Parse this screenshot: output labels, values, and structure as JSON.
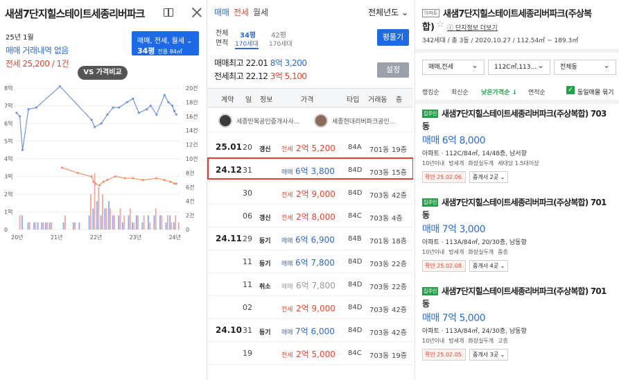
{
  "panel1": {
    "title": "새샘7단지힐스테이트세종리버파크",
    "month": "25년 1월",
    "no_sale": "매매 거래내역 없음",
    "jeonse": "전세 25,200 / 1건",
    "filter": {
      "types": "매매, 전세, 월세 ⌄",
      "area": "34평",
      "area_sub": "전용 84㎡"
    },
    "vs_label": "VS 가격비교"
  },
  "chart_data": {
    "type": "line",
    "x_ticks": [
      "20년",
      "21년",
      "22년",
      "23년",
      "24년"
    ],
    "y_left_ticks": [
      "8억",
      "7억",
      "6억",
      "5억",
      "4억",
      "3억",
      "2억",
      "1억",
      "0"
    ],
    "y_right_ticks": [
      "20건",
      "18건",
      "16건",
      "14건",
      "12건",
      "10건",
      "8건",
      "6건",
      "4건",
      "2건",
      "0"
    ],
    "ylim_left": [
      0,
      8
    ],
    "ylim_right": [
      0,
      20
    ],
    "series": [
      {
        "color": "#6f95e0",
        "points": [
          [
            2020.0,
            6.6
          ],
          [
            2020.08,
            6.4
          ],
          [
            2020.15,
            4.5
          ],
          [
            2020.3,
            6.8
          ],
          [
            2020.5,
            6.9
          ],
          [
            2021.1,
            8.1
          ],
          [
            2021.9,
            6.2
          ],
          [
            2021.98,
            5.8
          ],
          [
            2022.15,
            6.0
          ],
          [
            2022.3,
            6.5
          ],
          [
            2022.45,
            6.9
          ],
          [
            2022.6,
            6.9
          ],
          [
            2022.8,
            7.2
          ],
          [
            2022.95,
            7.4
          ],
          [
            2023.1,
            6.6
          ],
          [
            2023.3,
            6.8
          ],
          [
            2023.4,
            7.0
          ],
          [
            2023.55,
            6.5
          ],
          [
            2023.75,
            7.6
          ],
          [
            2023.85,
            7.2
          ],
          [
            2023.95,
            7.0
          ],
          [
            2024.0,
            6.7
          ],
          [
            2024.05,
            6.5
          ]
        ]
      },
      {
        "color": "#f0936e",
        "points": [
          [
            2021.15,
            3.5
          ],
          [
            2021.55,
            3.2
          ],
          [
            2021.9,
            3.0
          ],
          [
            2021.95,
            2.7
          ],
          [
            2022.0,
            2.6
          ],
          [
            2022.1,
            2.5
          ],
          [
            2022.2,
            2.7
          ],
          [
            2022.3,
            2.8
          ],
          [
            2022.5,
            3.0
          ],
          [
            2022.75,
            2.9
          ],
          [
            2022.95,
            2.9
          ],
          [
            2023.2,
            2.8
          ],
          [
            2023.55,
            2.9
          ],
          [
            2023.75,
            2.8
          ],
          [
            2023.9,
            2.7
          ],
          [
            2024.0,
            2.6
          ],
          [
            2024.05,
            2.6
          ]
        ]
      }
    ],
    "volume_bars": [
      {
        "x": 2020.05,
        "sale": 0,
        "jeonse": 2
      },
      {
        "x": 2020.15,
        "sale": 2,
        "jeonse": 0
      },
      {
        "x": 2020.3,
        "sale": 1,
        "jeonse": 1
      },
      {
        "x": 2020.45,
        "sale": 1,
        "jeonse": 1
      },
      {
        "x": 2020.55,
        "sale": 1,
        "jeonse": 0
      },
      {
        "x": 2020.65,
        "sale": 1,
        "jeonse": 1
      },
      {
        "x": 2020.75,
        "sale": 1,
        "jeonse": 1
      },
      {
        "x": 2020.85,
        "sale": 1,
        "jeonse": 1
      },
      {
        "x": 2021.2,
        "sale": 1,
        "jeonse": 2
      },
      {
        "x": 2021.45,
        "sale": 1,
        "jeonse": 1
      },
      {
        "x": 2021.6,
        "sale": 1,
        "jeonse": 0
      },
      {
        "x": 2021.85,
        "sale": 2,
        "jeonse": 5
      },
      {
        "x": 2021.95,
        "sale": 3,
        "jeonse": 8
      },
      {
        "x": 2022.05,
        "sale": 4,
        "jeonse": 6
      },
      {
        "x": 2022.15,
        "sale": 2,
        "jeonse": 5
      },
      {
        "x": 2022.25,
        "sale": 3,
        "jeonse": 3
      },
      {
        "x": 2022.35,
        "sale": 4,
        "jeonse": 3
      },
      {
        "x": 2022.45,
        "sale": 2,
        "jeonse": 2
      },
      {
        "x": 2022.6,
        "sale": 2,
        "jeonse": 3
      },
      {
        "x": 2022.7,
        "sale": 1,
        "jeonse": 2
      },
      {
        "x": 2022.85,
        "sale": 2,
        "jeonse": 3
      },
      {
        "x": 2022.95,
        "sale": 1,
        "jeonse": 1
      },
      {
        "x": 2023.05,
        "sale": 2,
        "jeonse": 2
      },
      {
        "x": 2023.2,
        "sale": 1,
        "jeonse": 2
      },
      {
        "x": 2023.35,
        "sale": 2,
        "jeonse": 1
      },
      {
        "x": 2023.5,
        "sale": 2,
        "jeonse": 3
      },
      {
        "x": 2023.65,
        "sale": 2,
        "jeonse": 2
      },
      {
        "x": 2023.8,
        "sale": 1,
        "jeonse": 2
      },
      {
        "x": 2023.9,
        "sale": 2,
        "jeonse": 1
      },
      {
        "x": 2024.0,
        "sale": 1,
        "jeonse": 2
      },
      {
        "x": 2024.08,
        "sale": 0,
        "jeonse": 1
      }
    ],
    "bar_colors": {
      "sale": "#8ea8ee",
      "jeonse": "#f3a79a"
    }
  },
  "panel2": {
    "tabs": [
      "매매",
      "전세",
      "월세"
    ],
    "year_select": "전체년도 ⌄",
    "area_label": "전체",
    "area_label2": "면적",
    "area_selected": "34평",
    "area_other": "42평",
    "hh_selected": "170세대",
    "hh_other": "170세대",
    "pyeong_btn": "평풀기",
    "max_sale": {
      "label": "매매최고",
      "date": "22.01",
      "price": "8억 3,200"
    },
    "max_jeonse": {
      "label": "전세최고",
      "date": "22.12",
      "price": "3억 5,100"
    },
    "setting_btn": "설정",
    "headers": [
      "계약",
      "일",
      "정보",
      "가격",
      "타입",
      "거래동",
      "층"
    ],
    "agents": [
      "세종만복공인중개사사...",
      "세종현대리버파크공인..."
    ],
    "rows": [
      {
        "date": "25.01",
        "day": "20",
        "info": "갱신",
        "type": "전세",
        "price": "2억 5,200",
        "unit": "84A",
        "dong": "701동",
        "floor": "19층",
        "kind": "jeon"
      },
      {
        "date": "24.12",
        "day": "31",
        "info": "",
        "type": "매매",
        "price": "6억 3,800",
        "unit": "84D",
        "dong": "703동",
        "floor": "15층",
        "kind": "sale"
      },
      {
        "date": "",
        "day": "30",
        "info": "",
        "type": "전세",
        "price": "2억 9,000",
        "unit": "84D",
        "dong": "703동",
        "floor": "42층",
        "kind": "jeon"
      },
      {
        "date": "",
        "day": "06",
        "info": "갱신",
        "type": "전세",
        "price": "2억 8,000",
        "unit": "84C",
        "dong": "703동",
        "floor": "4층",
        "kind": "jeon"
      },
      {
        "date": "24.11",
        "day": "29",
        "info": "등기",
        "type": "매매",
        "price": "6억 6,900",
        "unit": "84B",
        "dong": "701동",
        "floor": "18층",
        "kind": "sale"
      },
      {
        "date": "",
        "day": "11",
        "info": "등기",
        "type": "매매",
        "price": "6억 7,800",
        "unit": "84D",
        "dong": "703동",
        "floor": "22층",
        "kind": "sale"
      },
      {
        "date": "",
        "day": "11",
        "info": "취소",
        "type": "매매",
        "price": "6억 7,800",
        "unit": "84D",
        "dong": "703동",
        "floor": "22층",
        "kind": "cancel"
      },
      {
        "date": "",
        "day": "02",
        "info": "",
        "type": "전세",
        "price": "2억 9,000",
        "unit": "84D",
        "dong": "703동",
        "floor": "42층",
        "kind": "jeon"
      },
      {
        "date": "24.10",
        "day": "31",
        "info": "등기",
        "type": "매매",
        "price": "7억 6,000",
        "unit": "84D",
        "dong": "703동",
        "floor": "42층",
        "kind": "sale"
      },
      {
        "date": "",
        "day": "19",
        "info": "",
        "type": "전세",
        "price": "2억 5,000",
        "unit": "84C",
        "dong": "703동",
        "floor": "19층",
        "kind": "jeon"
      }
    ]
  },
  "panel3": {
    "badge": "아파트",
    "title_line1": "새샘7단지힐스테이트세종리버파크(주상복",
    "title_line2": "합)",
    "info_link": "단지정보 더보기",
    "meta": "342세대 / 총 3동 / 2020.10.27 / 112.54㎡ ~ 189.3㎡",
    "dropdowns": [
      "매매,전세",
      "112C㎡,113...",
      "전체동"
    ],
    "sorts": [
      "랭킹순",
      "최신순",
      "낮은가격순 ↓",
      "면적순"
    ],
    "same_listing": "동일매물 묶기",
    "cards": [
      {
        "tag": "집주인",
        "name1": "새샘7단지힐스테이트세종리버파크(주상복합) 703",
        "name2": "동",
        "price": "매매 6억 8,000",
        "spec": "아파트 · 112C/84㎡, 14/48층, 남서향",
        "tags": [
          "10년이내",
          "방세개",
          "화장실두개",
          "세대당 1.5대이상"
        ],
        "confirm": "확인 25.02.06.",
        "broker": "중개사 2곳"
      },
      {
        "tag": "집주인",
        "name1": "새샘7단지힐스테이트세종리버파크(주상복합) 701",
        "name2": "동",
        "price": "매매 7억 3,000",
        "spec": "아파트 · 113A/84㎡, 20/30층, 남동향",
        "tags": [
          "10년이내",
          "방세개",
          "화장실두개",
          "중층"
        ],
        "confirm": "확인 25.02.08.",
        "broker": "중개사 4곳"
      },
      {
        "tag": "집주인",
        "name1": "새샘7단지힐스테이트세종리버파크(주상복합) 701",
        "name2": "동",
        "price": "매매 7억 5,000",
        "spec": "아파트 · 113A/84㎡, 24/30층, 남동향",
        "tags": [
          "10년이내",
          "방세개",
          "화장실두개",
          "고층"
        ],
        "confirm": "확인 25.02.05.",
        "broker": "중개사 3곳"
      }
    ]
  }
}
